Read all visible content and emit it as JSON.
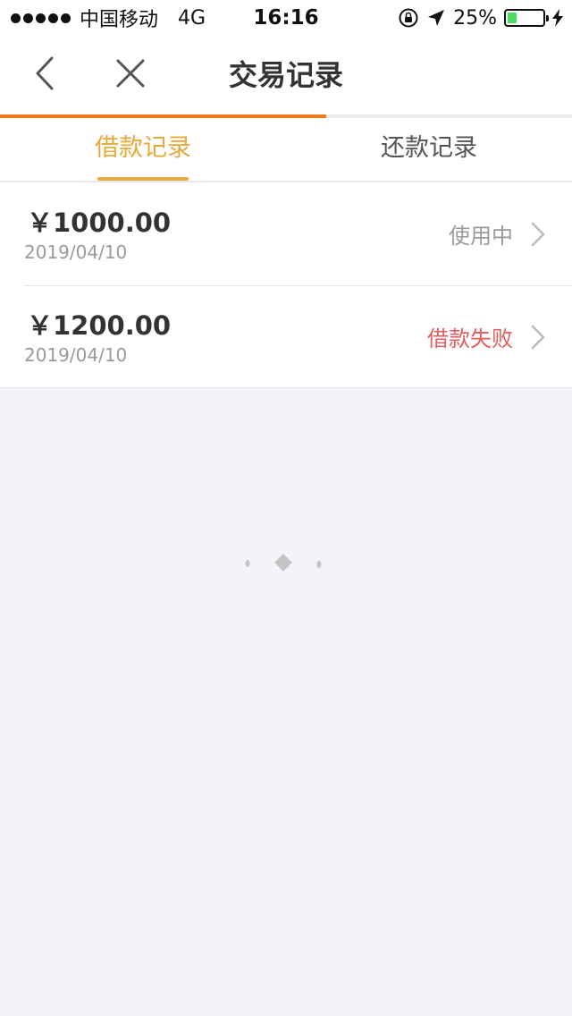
{
  "status_bar": {
    "carrier": "中国移动",
    "network": "4G",
    "time": "16:16",
    "battery_text": "25%",
    "battery_level": 0.25
  },
  "nav": {
    "title": "交易记录",
    "back_icon": "chevron-left-icon",
    "close_icon": "close-icon",
    "page_load_progress": 0.57
  },
  "tabs": [
    {
      "label": "借款记录",
      "active": true
    },
    {
      "label": "还款记录",
      "active": false
    }
  ],
  "records": [
    {
      "amount": "￥1000.00",
      "date": "2019/04/10",
      "status": "使用中",
      "status_color": "#9a9a9a"
    },
    {
      "amount": "￥1200.00",
      "date": "2019/04/10",
      "status": "借款失败",
      "status_color": "#e45c5c"
    }
  ],
  "colors": {
    "accent": "#e7a93a",
    "progress": "#f07b17",
    "fail": "#e45c5c",
    "background": "#f4f4f8"
  }
}
